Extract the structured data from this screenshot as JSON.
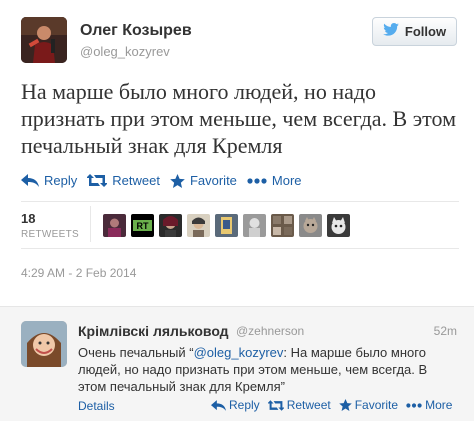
{
  "tweet": {
    "author_name": "Олег Козырев",
    "author_handle": "@oleg_kozyrev",
    "follow_label": "Follow",
    "text": "На марше было много людей, но надо признать при этом меньше, чем всегда. В этом печальный знак для Кремля",
    "actions": {
      "reply": "Reply",
      "retweet": "Retweet",
      "favorite": "Favorite",
      "more": "More"
    },
    "retweet_count": "18",
    "retweets_label": "RETWEETS",
    "retweeter_avatars": [
      "avatar-1",
      "avatar-rt-logo",
      "avatar-3",
      "avatar-4",
      "avatar-5",
      "avatar-6",
      "avatar-7",
      "avatar-8",
      "avatar-9",
      "avatar-10"
    ],
    "rt_logo_text": "RT",
    "timestamp": "4:29 AM - 2 Feb 2014"
  },
  "reply": {
    "author_name": "Крімлівскі ляльковод",
    "author_handle": "@zehnerson",
    "time": "52m",
    "text_before": "Очень печальный “",
    "mention": "@oleg_kozyrev",
    "text_after": ": На марше было много людей, но надо признать при этом меньше, чем всегда. В этом печальный знак для Кремля”",
    "details_label": "Details",
    "actions": {
      "reply": "Reply",
      "retweet": "Retweet",
      "favorite": "Favorite",
      "more": "More"
    }
  },
  "colors": {
    "link": "#1d5fa5",
    "twitter_bird": "#55acee",
    "muted": "#999999",
    "text": "#333333"
  }
}
